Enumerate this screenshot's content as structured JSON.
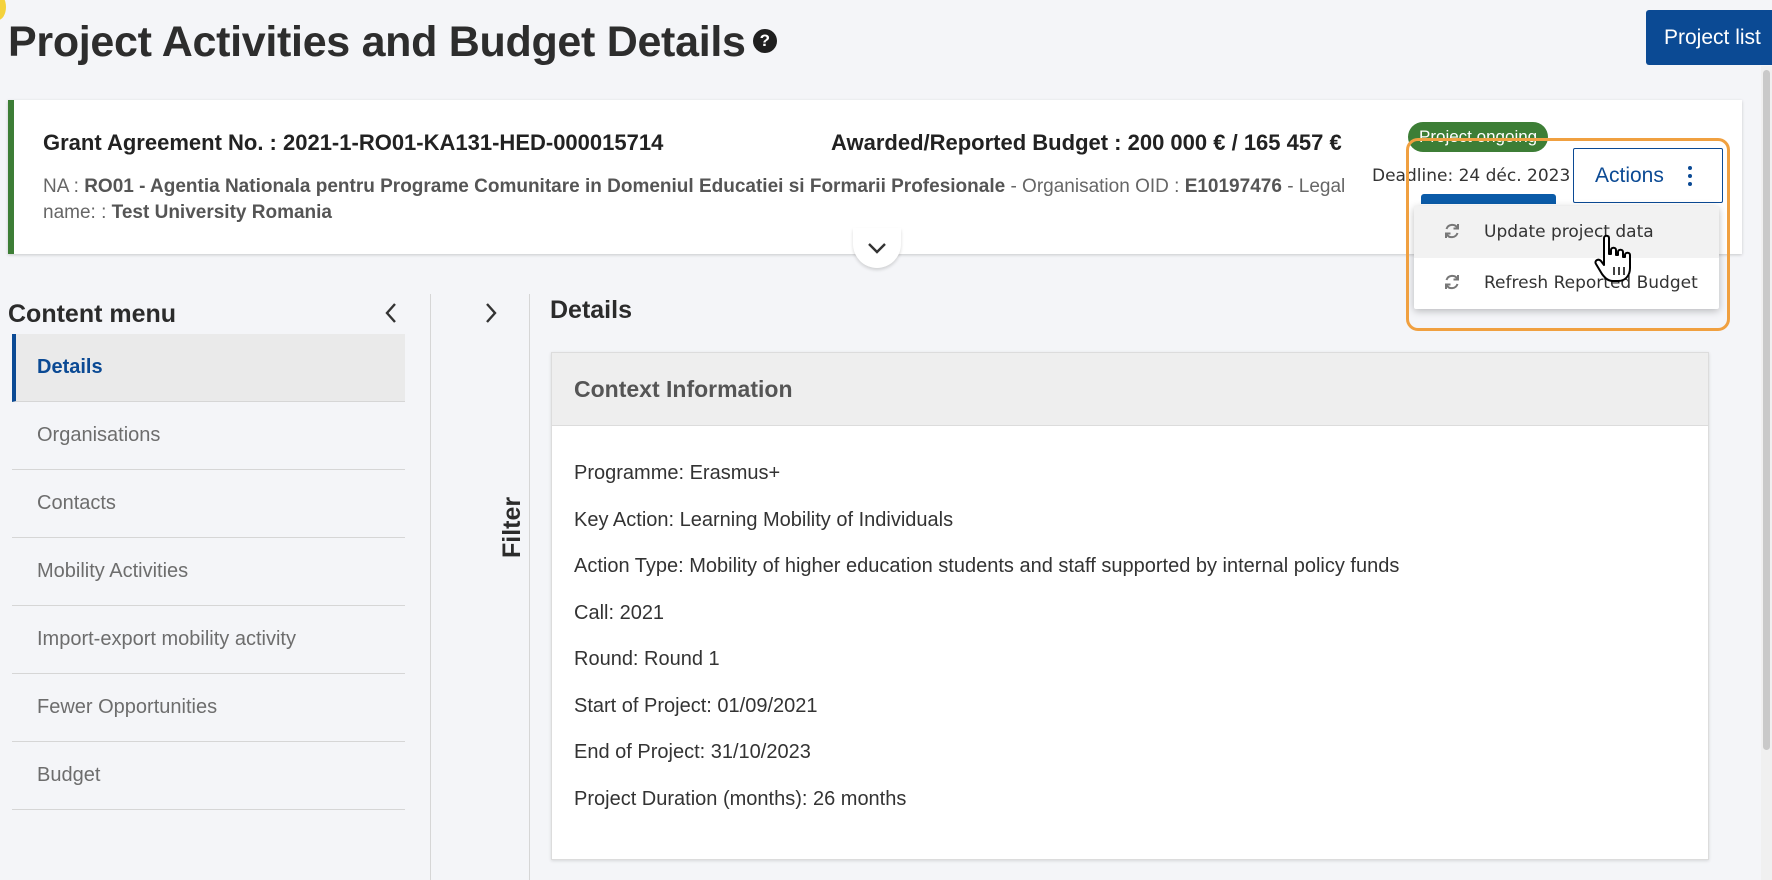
{
  "page": {
    "title": "Project Activities and Budget Details",
    "help_icon": "?",
    "project_list_label": "Project list"
  },
  "grant": {
    "agreement_label": "Grant Agreement No. : 2021-1-RO01-KA131-HED-000015714",
    "budget_label": "Awarded/Reported Budget : 200 000 € / 165 457 €",
    "na_prefix": "NA :",
    "na_value": "RO01 - Agentia Nationala pentru Programe Comunitare in Domeniul Educatiei si Formarii Profesionale",
    "oid_prefix": "- Organisation OID :",
    "oid_value": "E10197476",
    "legal_prefix": "- Legal name: :",
    "legal_value": "Test University Romania",
    "status": "Project ongoing",
    "deadline": "Deadline: 24 déc. 2023",
    "status_color": "#3d7e36"
  },
  "actions": {
    "label": "Actions",
    "menu": [
      {
        "label": "Update project data",
        "icon": "refresh-icon"
      },
      {
        "label": "Refresh Reported Budget",
        "icon": "refresh-icon"
      }
    ]
  },
  "content_menu": {
    "title": "Content menu",
    "items": [
      {
        "label": "Details"
      },
      {
        "label": "Organisations"
      },
      {
        "label": "Contacts"
      },
      {
        "label": "Mobility Activities"
      },
      {
        "label": "Import-export mobility activity"
      },
      {
        "label": "Fewer Opportunities"
      },
      {
        "label": "Budget"
      }
    ]
  },
  "filter": {
    "label": "Filter"
  },
  "details": {
    "title": "Details",
    "context_title": "Context Information",
    "lines": [
      "Programme: Erasmus+",
      "Key Action: Learning Mobility of Individuals",
      "Action Type: Mobility of higher education students and staff supported by internal policy funds",
      "Call: 2021",
      "Round: Round 1",
      "Start of Project: 01/09/2021",
      "End of Project: 31/10/2023",
      "Project Duration (months): 26 months"
    ]
  },
  "colors": {
    "brand_blue": "#0b4a94",
    "highlight_orange": "#f0a040"
  }
}
